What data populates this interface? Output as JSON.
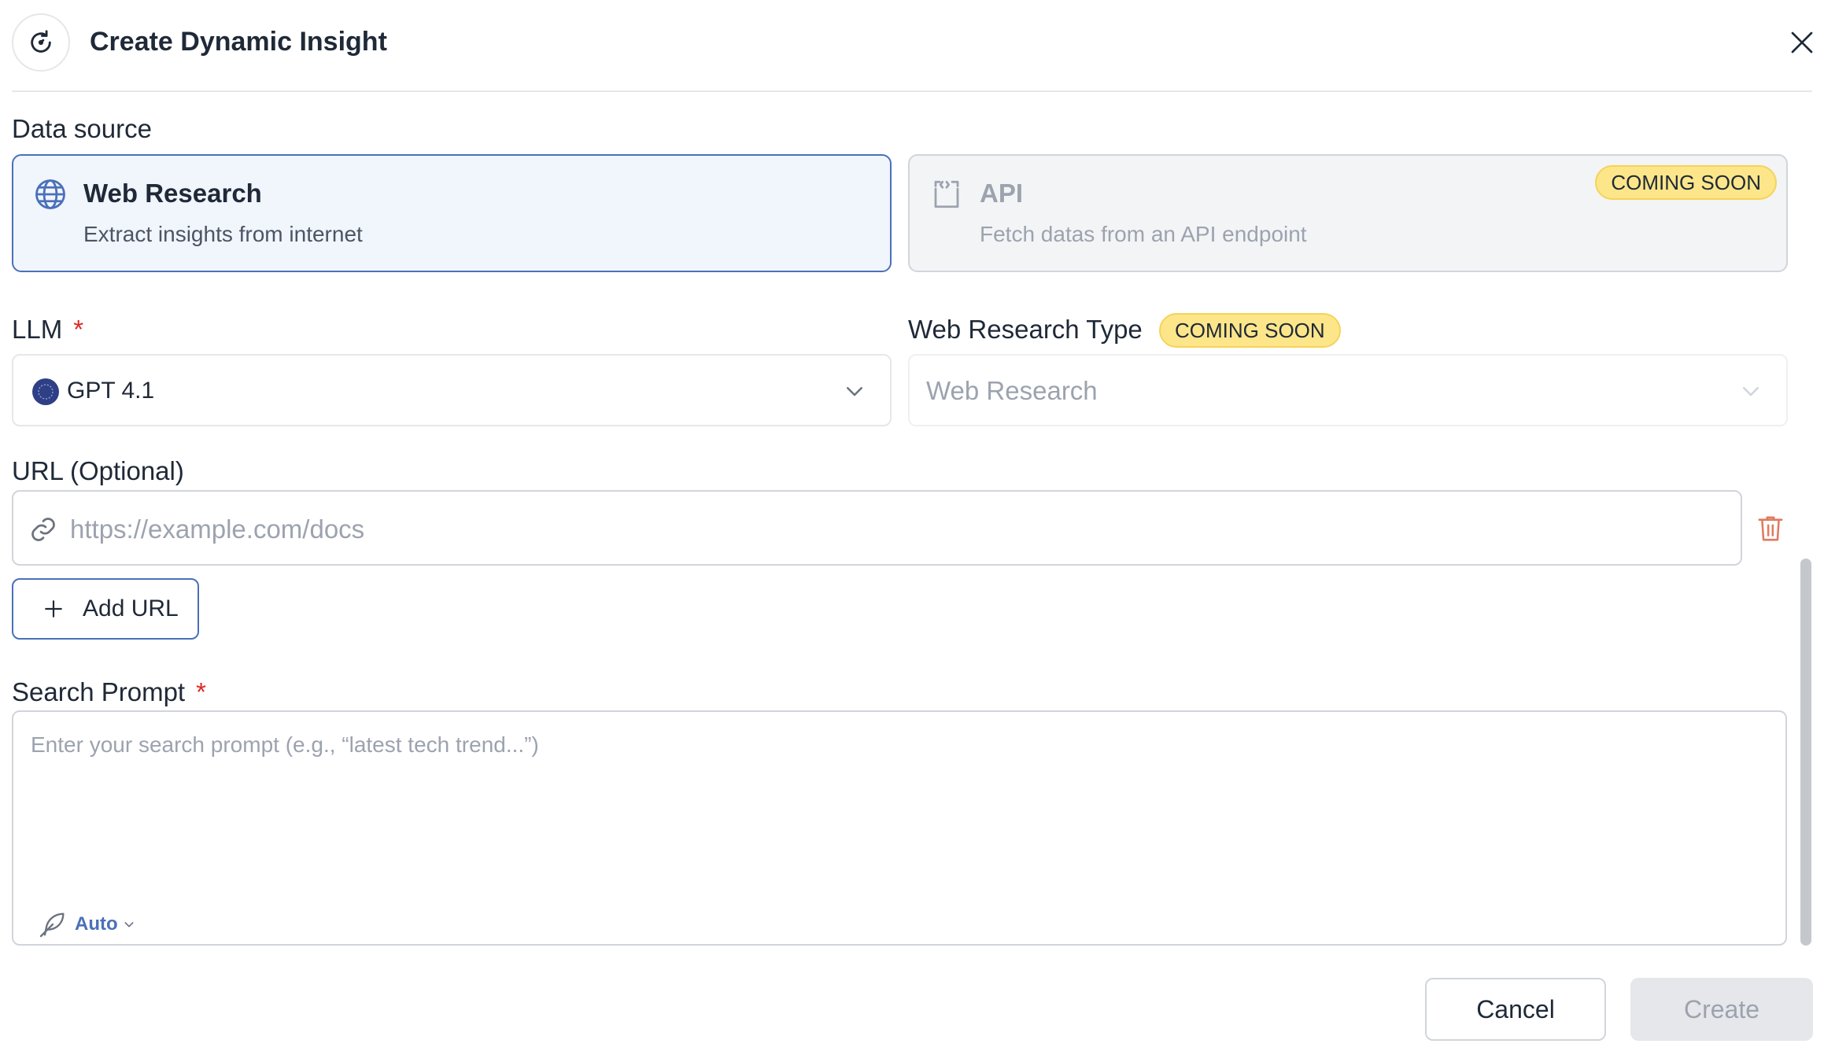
{
  "header": {
    "title": "Create Dynamic Insight"
  },
  "data_source": {
    "label": "Data source",
    "options": [
      {
        "title": "Web Research",
        "description": "Extract insights from internet",
        "selected": true
      },
      {
        "title": "API",
        "description": "Fetch datas from an API endpoint",
        "badge": "COMING SOON",
        "selected": false
      }
    ]
  },
  "llm": {
    "label": "LLM",
    "required_mark": "*",
    "value": "GPT 4.1"
  },
  "web_research_type": {
    "label": "Web Research Type",
    "badge": "COMING SOON",
    "value": "Web Research"
  },
  "url": {
    "label": "URL (Optional)",
    "placeholder": "https://example.com/docs",
    "value": "",
    "add_label": "Add URL"
  },
  "search_prompt": {
    "label": "Search Prompt",
    "required_mark": "*",
    "placeholder": "Enter your search prompt (e.g., “latest tech trend...”)",
    "mode": "Auto"
  },
  "footer": {
    "cancel_label": "Cancel",
    "create_label": "Create"
  },
  "colors": {
    "accent": "#4a70b8",
    "badge_bg": "#fde68a",
    "required": "#dc2626",
    "trash": "#e07a5f"
  },
  "icons": {
    "header": "refresh-icon",
    "close": "close-icon",
    "web": "globe-icon",
    "api": "code-bracket-icon",
    "llm": "openai-logo-icon",
    "chevron": "chevron-down-icon",
    "link": "link-icon",
    "trash": "trash-icon",
    "add": "plus-icon",
    "mode": "feather-icon"
  }
}
